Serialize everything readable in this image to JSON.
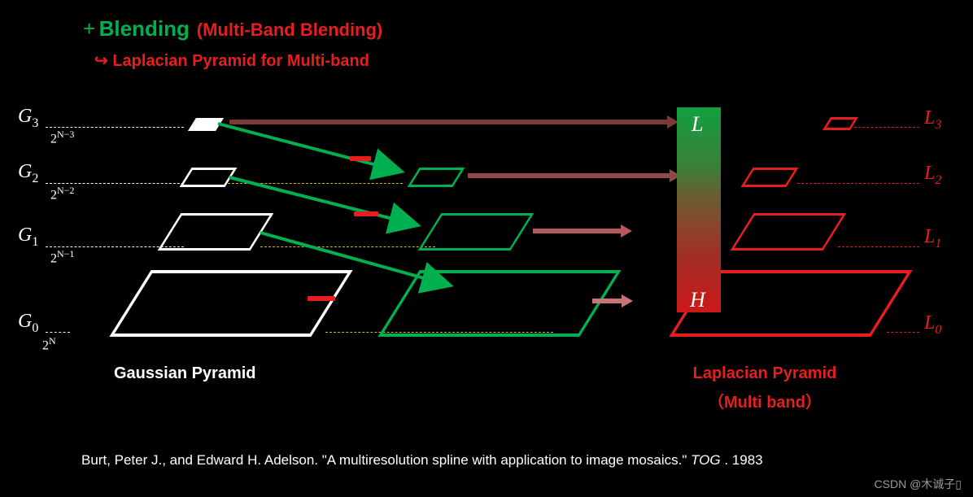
{
  "title": {
    "plus": "+",
    "main": "Blending",
    "sub": "(Multi-Band Blending)"
  },
  "subtitle": {
    "arrow": "↪",
    "text": "Laplacian Pyramid for Multi-band"
  },
  "gaussian": {
    "caption": "Gaussian Pyramid",
    "levels": [
      {
        "g": "G",
        "gi": "0",
        "pow_base": "2",
        "pow_exp": "N"
      },
      {
        "g": "G",
        "gi": "1",
        "pow_base": "2",
        "pow_exp": "N−1"
      },
      {
        "g": "G",
        "gi": "2",
        "pow_base": "2",
        "pow_exp": "N−2"
      },
      {
        "g": "G",
        "gi": "3",
        "pow_base": "2",
        "pow_exp": "N−3"
      }
    ]
  },
  "laplacian": {
    "caption_line1": "Laplacian Pyramid",
    "caption_line2": "（Multi band）",
    "levels": [
      {
        "l": "L",
        "li": "0"
      },
      {
        "l": "L",
        "li": "1"
      },
      {
        "l": "L",
        "li": "2"
      },
      {
        "l": "L",
        "li": "3"
      }
    ]
  },
  "freq": {
    "low": "L",
    "high": "H"
  },
  "citation": {
    "pre": "Burt, Peter J., and Edward H. Adelson. \"A multiresolution spline with application to image mosaics.\" ",
    "journal": "TOG",
    "post": " . 1983"
  },
  "watermark": "CSDN @木诚子▯"
}
